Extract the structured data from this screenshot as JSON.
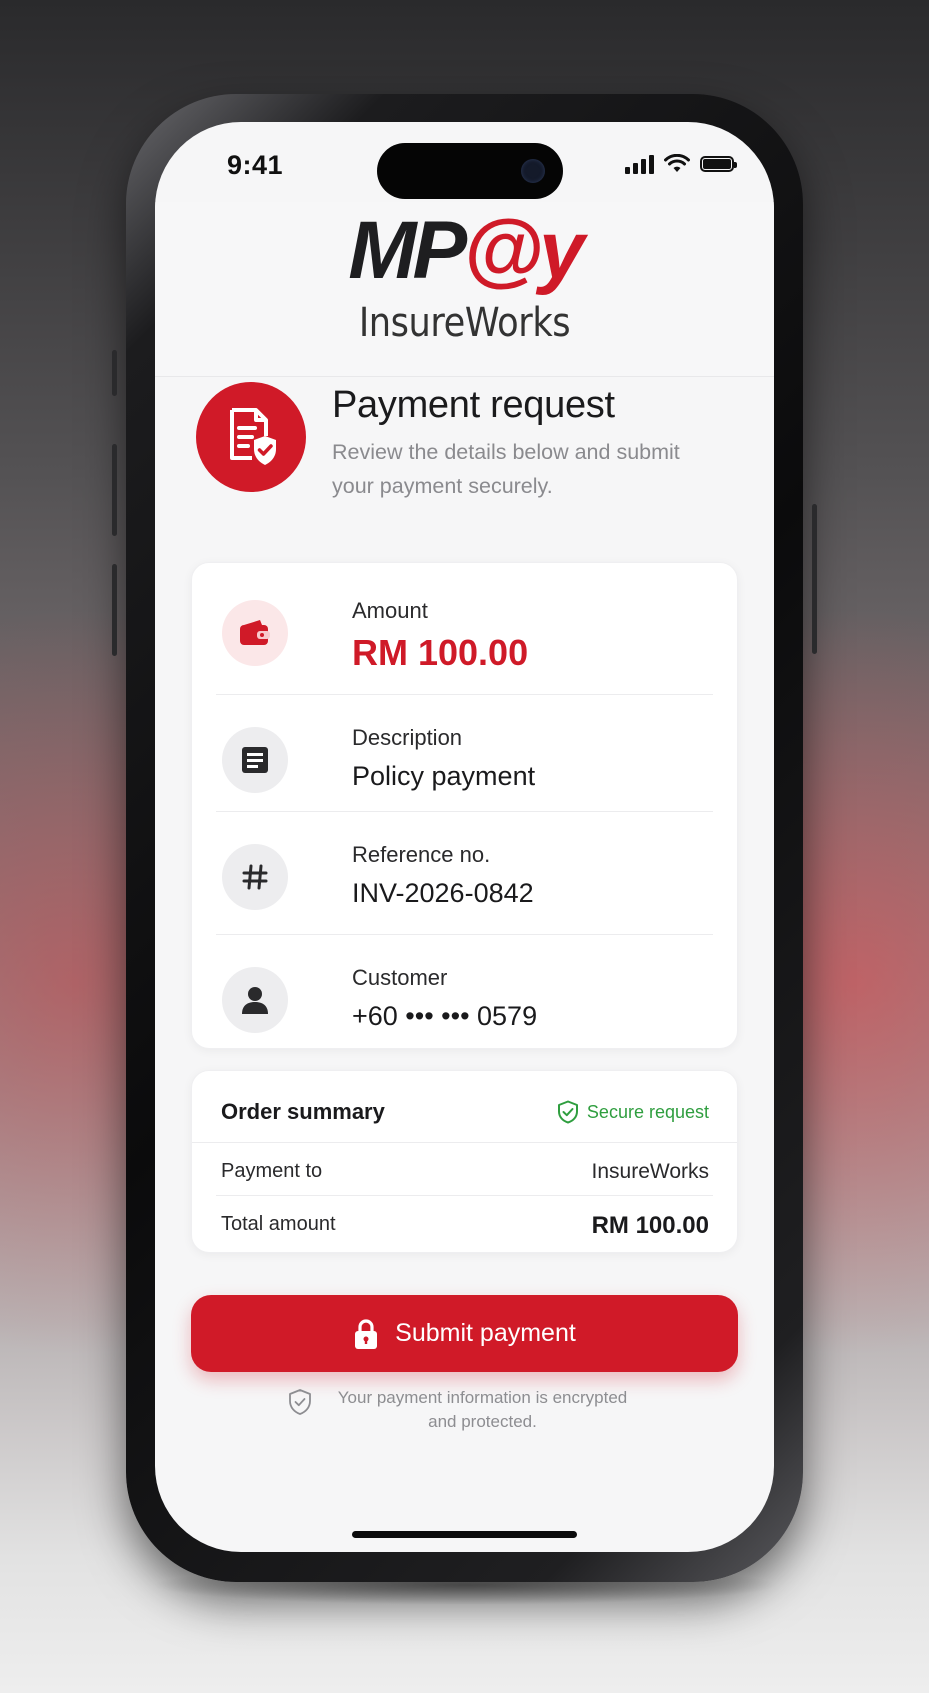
{
  "status_bar": {
    "time": "9:41"
  },
  "header": {
    "logo_part1": "MP",
    "logo_part2": "@y",
    "brand": "InsureWorks"
  },
  "intro": {
    "title": "Payment request",
    "subtitle": "Review the details below and submit your payment securely.",
    "icon": "document-shield-icon"
  },
  "details": [
    {
      "icon": "wallet-icon",
      "label": "Amount",
      "value": "RM 100.00"
    },
    {
      "icon": "document-icon",
      "label": "Description",
      "value": "Policy payment"
    },
    {
      "icon": "hash-icon",
      "label": "Reference no.",
      "value": "INV-2026-0842"
    },
    {
      "icon": "user-icon",
      "label": "Customer",
      "value": "+60 ••• ••• 0579"
    }
  ],
  "summary": {
    "title": "Order summary",
    "secure_label": "Secure request",
    "payment_to_label": "Payment to",
    "payment_to_value": "InsureWorks",
    "total_label": "Total amount",
    "total_value": "RM 100.00"
  },
  "submit_label": "Submit payment",
  "footer_note": "Your payment information is encrypted and protected.",
  "colors": {
    "brand_red": "#d01a28",
    "secure_green": "#2f9e3f"
  }
}
